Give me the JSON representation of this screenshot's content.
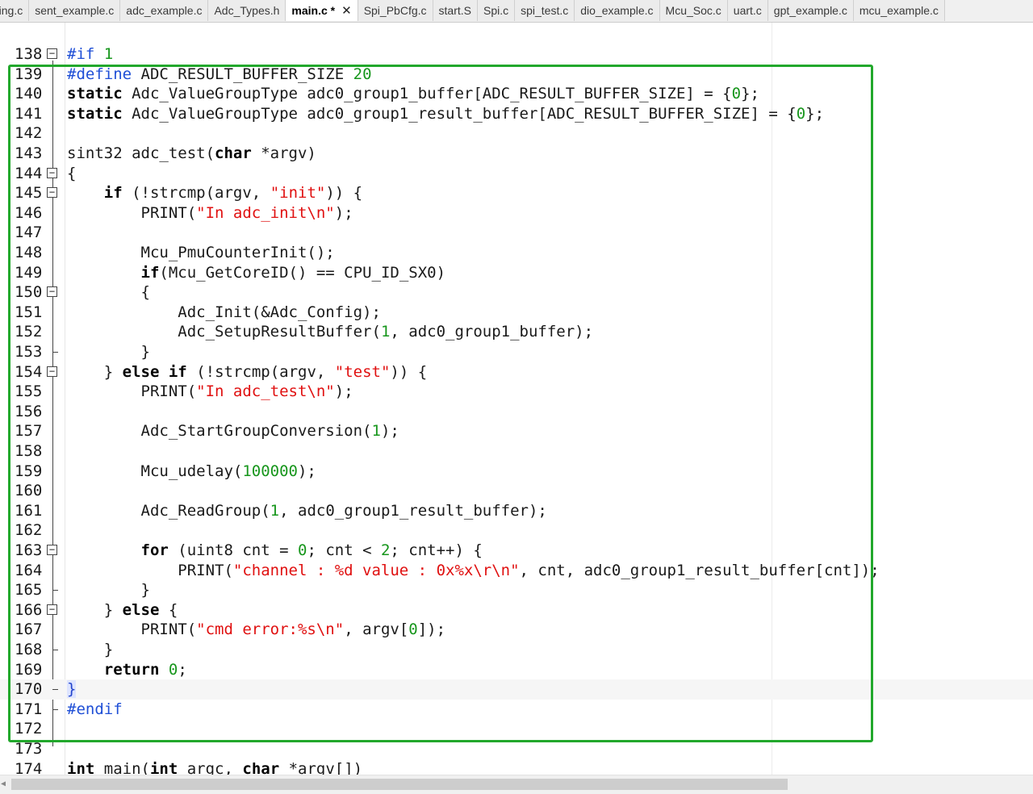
{
  "tabs": [
    {
      "label": "ring.c"
    },
    {
      "label": "sent_example.c"
    },
    {
      "label": "adc_example.c"
    },
    {
      "label": "Adc_Types.h"
    },
    {
      "label": "main.c *",
      "active": true
    },
    {
      "label": "Spi_PbCfg.c"
    },
    {
      "label": "start.S"
    },
    {
      "label": "Spi.c"
    },
    {
      "label": "spi_test.c"
    },
    {
      "label": "dio_example.c"
    },
    {
      "label": "Mcu_Soc.c"
    },
    {
      "label": "uart.c"
    },
    {
      "label": "gpt_example.c"
    },
    {
      "label": "mcu_example.c"
    }
  ],
  "close_glyph": "✕",
  "lines": [
    {
      "n": "138",
      "fold": "minus",
      "code": "#if 1"
    },
    {
      "n": "139",
      "fold": "",
      "code": "#define ADC_RESULT_BUFFER_SIZE 20"
    },
    {
      "n": "140",
      "fold": "",
      "code": "static Adc_ValueGroupType adc0_group1_buffer[ADC_RESULT_BUFFER_SIZE] = {0};"
    },
    {
      "n": "141",
      "fold": "",
      "code": "static Adc_ValueGroupType adc0_group1_result_buffer[ADC_RESULT_BUFFER_SIZE] = {0};"
    },
    {
      "n": "142",
      "fold": "",
      "code": ""
    },
    {
      "n": "143",
      "fold": "",
      "code": "sint32 adc_test(char *argv)"
    },
    {
      "n": "144",
      "fold": "minus",
      "code": "{"
    },
    {
      "n": "145",
      "fold": "minus",
      "code": "    if (!strcmp(argv, \"init\")) {"
    },
    {
      "n": "146",
      "fold": "",
      "code": "        PRINT(\"In adc_init\\n\");"
    },
    {
      "n": "147",
      "fold": "",
      "code": ""
    },
    {
      "n": "148",
      "fold": "",
      "code": "        Mcu_PmuCounterInit();"
    },
    {
      "n": "149",
      "fold": "",
      "code": "        if(Mcu_GetCoreID() == CPU_ID_SX0)"
    },
    {
      "n": "150",
      "fold": "minus",
      "code": "        {"
    },
    {
      "n": "151",
      "fold": "",
      "code": "            Adc_Init(&Adc_Config);"
    },
    {
      "n": "152",
      "fold": "",
      "code": "            Adc_SetupResultBuffer(1, adc0_group1_buffer);"
    },
    {
      "n": "153",
      "fold": "end",
      "code": "        }"
    },
    {
      "n": "154",
      "fold": "minus",
      "code": "    } else if (!strcmp(argv, \"test\")) {"
    },
    {
      "n": "155",
      "fold": "",
      "code": "        PRINT(\"In adc_test\\n\");"
    },
    {
      "n": "156",
      "fold": "",
      "code": ""
    },
    {
      "n": "157",
      "fold": "",
      "code": "        Adc_StartGroupConversion(1);"
    },
    {
      "n": "158",
      "fold": "",
      "code": ""
    },
    {
      "n": "159",
      "fold": "",
      "code": "        Mcu_udelay(100000);"
    },
    {
      "n": "160",
      "fold": "",
      "code": ""
    },
    {
      "n": "161",
      "fold": "",
      "code": "        Adc_ReadGroup(1, adc0_group1_result_buffer);"
    },
    {
      "n": "162",
      "fold": "",
      "code": ""
    },
    {
      "n": "163",
      "fold": "minus",
      "code": "        for (uint8 cnt = 0; cnt < 2; cnt++) {"
    },
    {
      "n": "164",
      "fold": "",
      "code": "            PRINT(\"channel : %d value : 0x%x\\r\\n\", cnt, adc0_group1_result_buffer[cnt]);"
    },
    {
      "n": "165",
      "fold": "end",
      "code": "        }"
    },
    {
      "n": "166",
      "fold": "minus",
      "code": "    } else {"
    },
    {
      "n": "167",
      "fold": "",
      "code": "        PRINT(\"cmd error:%s\\n\", argv[0]);"
    },
    {
      "n": "168",
      "fold": "end",
      "code": "    }"
    },
    {
      "n": "169",
      "fold": "",
      "code": "    return 0;"
    },
    {
      "n": "170",
      "fold": "end",
      "code": "}",
      "current": true
    },
    {
      "n": "171",
      "fold": "end",
      "code": "#endif"
    },
    {
      "n": "172",
      "fold": "",
      "code": ""
    },
    {
      "n": "173",
      "fold": "",
      "code": ""
    },
    {
      "n": "174",
      "fold": "",
      "code": "int main(int argc, char *argv[])"
    }
  ],
  "colors": {
    "highlight_box": "#22a82c",
    "keyword": "#000000",
    "preprocessor": "#1f4fd6",
    "string": "#e01010",
    "number": "#17961c"
  }
}
